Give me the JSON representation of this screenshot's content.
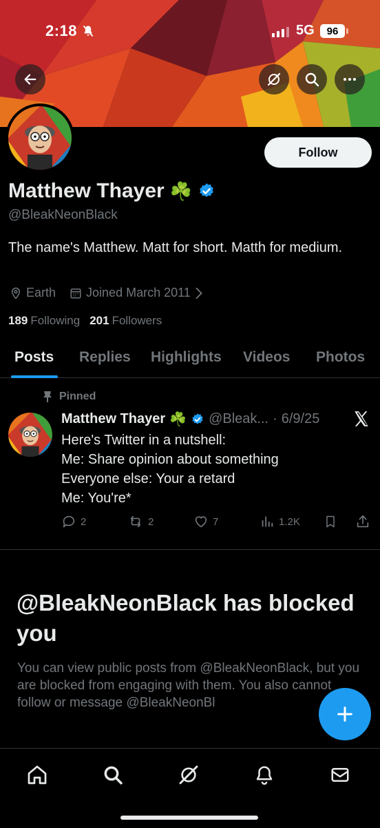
{
  "status_bar": {
    "time": "2:18",
    "network": "5G",
    "battery": "96"
  },
  "profile": {
    "display_name": "Matthew Thayer",
    "name_emoji": "☘️",
    "handle": "@BleakNeonBlack",
    "bio": "The name's Matthew. Matt for short. Matth for medium.",
    "location": "Earth",
    "joined": "Joined March 2011",
    "following_count": "189",
    "following_label": "Following",
    "followers_count": "201",
    "followers_label": "Followers",
    "follow_label": "Follow"
  },
  "tabs": [
    {
      "label": "Posts"
    },
    {
      "label": "Replies"
    },
    {
      "label": "Highlights"
    },
    {
      "label": "Videos"
    },
    {
      "label": "Photos"
    }
  ],
  "pinned_post": {
    "pinned_label": "Pinned",
    "author": "Matthew Thayer",
    "emoji": "☘️",
    "handle": "@Bleak...",
    "separator": "·",
    "date": "6/9/25",
    "text": "Here's Twitter in a nutshell:\nMe: Share opinion about something\nEveryone else: Your a retard\nMe: You're*",
    "replies": "2",
    "reposts": "2",
    "likes": "7",
    "views": "1.2K"
  },
  "blocked": {
    "title": "@BleakNeonBlack has blocked you",
    "body": "You can view public posts from @BleakNeonBlack, but you are blocked from engaging with them. You also cannot follow or message @BleakNeonBl"
  },
  "icons": {
    "back": "back-arrow-icon",
    "grok": "grok-icon",
    "search": "search-icon",
    "more": "more-icon",
    "verified": "verified-badge-icon",
    "location": "location-pin-icon",
    "calendar": "calendar-icon",
    "chevron": "chevron-right-icon",
    "pin": "pin-icon",
    "x_logo": "x-logo-icon",
    "reply": "reply-icon",
    "repost": "repost-icon",
    "like": "heart-icon",
    "views": "views-icon",
    "bookmark": "bookmark-icon",
    "share": "share-icon",
    "compose": "plus-icon",
    "nav_home": "home-icon",
    "nav_search": "search-icon",
    "nav_grok": "grok-icon",
    "nav_notifications": "bell-icon",
    "nav_messages": "mail-icon"
  },
  "colors": {
    "accent": "#1d9bf0",
    "muted": "#71767b",
    "text": "#e7e9ea",
    "divider": "#2f3336"
  }
}
